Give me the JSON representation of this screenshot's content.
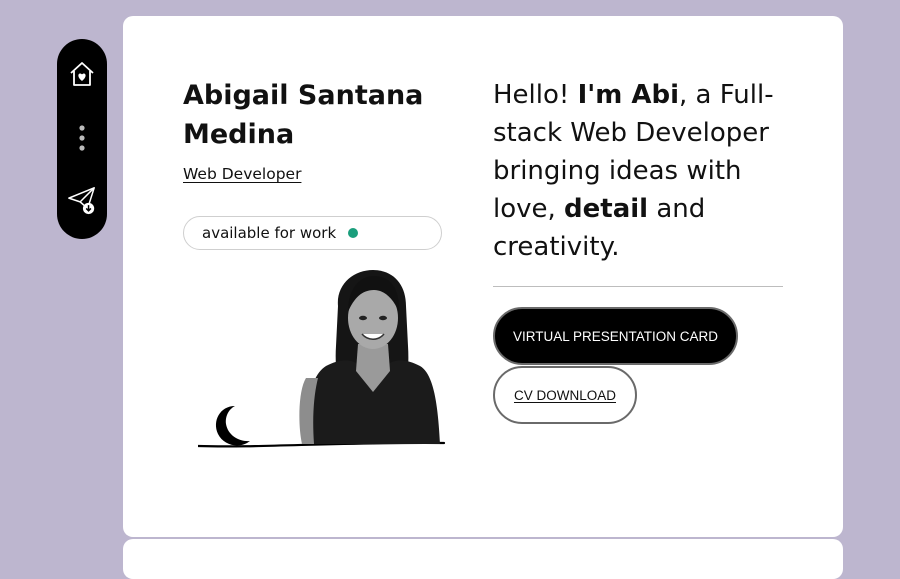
{
  "sidebar": {
    "items": [
      {
        "icon": "home-heart-icon"
      },
      {
        "icon": "more-vertical-icon"
      },
      {
        "icon": "send-download-icon"
      }
    ]
  },
  "profile": {
    "name": "Abigail Santana Medina",
    "role": "Web Developer",
    "status": "available for work",
    "status_color": "#1a9e7c"
  },
  "intro": {
    "part1": "Hello! ",
    "bold1": "I'm Abi",
    "part2": ", a Full-stack Web Developer bringing ideas with love, ",
    "bold2": "detail",
    "part3": " and creativity."
  },
  "actions": {
    "primary_label": "VIRTUAL PRESENTATION CARD",
    "secondary_label": "CV DOWNLOAD"
  },
  "theme": {
    "background": "#bdb6cf",
    "card": "#ffffff",
    "accent": "#000000"
  }
}
